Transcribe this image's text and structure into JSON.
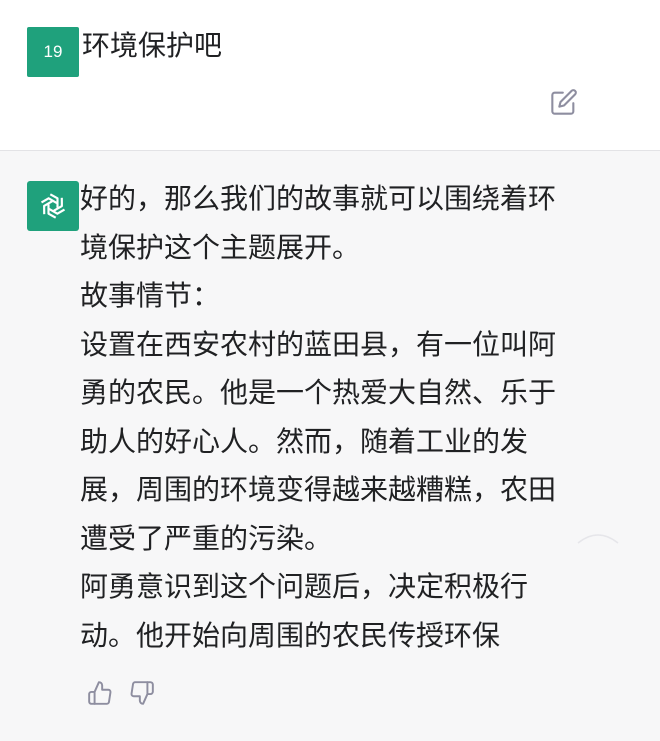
{
  "user_message": {
    "avatar_text": "19",
    "text": "环境保护吧"
  },
  "assistant_message": {
    "paragraphs": [
      "好的，那么我们的故事就可以围绕着环境保护这个主题展开。",
      "故事情节：",
      "设置在西安农村的蓝田县，有一位叫阿勇的农民。他是一个热爱大自然、乐于助人的好心人。然而，随着工业的发展，周围的环境变得越来越糟糕，农田遭受了严重的污染。",
      "阿勇意识到这个问题后，决定积极行动。他开始向周围的农民传授环保"
    ]
  },
  "icons": {
    "edit": "edit-icon",
    "bot": "openai-logo-icon",
    "thumbs_up": "thumbs-up-icon",
    "thumbs_down": "thumbs-down-icon"
  },
  "colors": {
    "avatar_green": "#1fa17c",
    "assistant_bg": "#f7f7f8",
    "icon_gray": "#8e8ea0"
  }
}
